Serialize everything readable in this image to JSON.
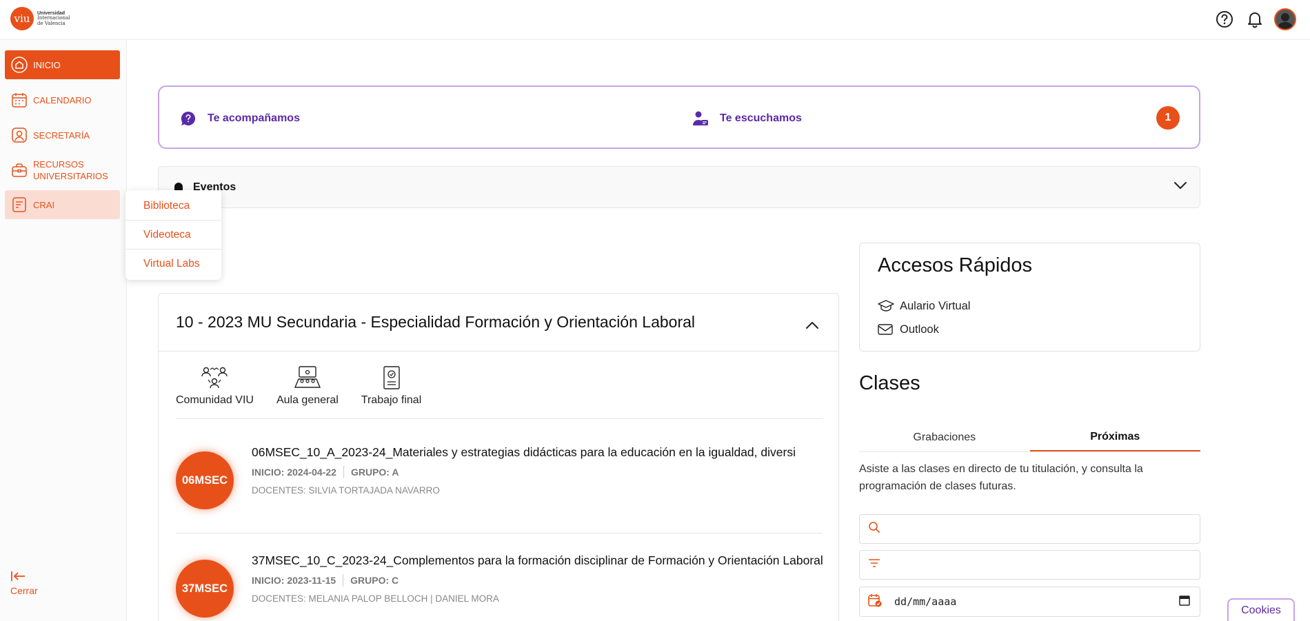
{
  "header": {
    "logo_mark": "viu",
    "logo_line1": "Universidad",
    "logo_line2": "Internacional",
    "logo_line3": "de Valencia",
    "icons": [
      "help-icon",
      "bell-icon",
      "avatar"
    ]
  },
  "sidebar": {
    "items": [
      {
        "label": "INICIO",
        "icon": "home-icon",
        "state": "active"
      },
      {
        "label": "CALENDARIO",
        "icon": "calendar-icon",
        "state": "normal"
      },
      {
        "label": "SECRETARÍA",
        "icon": "user-badge-icon",
        "state": "normal"
      },
      {
        "label": "RECURSOS UNIVERSITARIOS",
        "label_line1": "RECURSOS",
        "label_line2": "UNIVERSITARIOS",
        "icon": "briefcase-icon",
        "state": "normal"
      },
      {
        "label": "CRAI",
        "icon": "book-icon",
        "state": "highlight"
      }
    ],
    "close_label": "Cerrar"
  },
  "crai_menu": {
    "items": [
      "Biblioteca",
      "Videoteca",
      "Virtual Labs"
    ]
  },
  "banner": {
    "item1": "Te acompañamos",
    "item2": "Te escuchamos",
    "badge": "1"
  },
  "eventos": {
    "title": "Eventos"
  },
  "course": {
    "title": "10 - 2023 MU Secundaria - Especialidad Formación y Orientación Laboral",
    "tools": [
      {
        "label": "Comunidad VIU"
      },
      {
        "label": "Aula general"
      },
      {
        "label": "Trabajo final"
      }
    ],
    "subjects": [
      {
        "code": "06MSEC",
        "title": "06MSEC_10_A_2023-24_Materiales y estrategias didácticas para la educación en la igualdad, diversi",
        "inicio": "INICIO: 2024-04-22",
        "grupo": "GRUPO: A",
        "docentes": "DOCENTES: SILVIA TORTAJADA NAVARRO"
      },
      {
        "code": "37MSEC",
        "title": "37MSEC_10_C_2023-24_Complementos para la formación disciplinar de Formación y Orientación Laboral",
        "inicio": "INICIO: 2023-11-15",
        "grupo": "GRUPO: C",
        "docentes": "DOCENTES: MELANIA PALOP BELLOCH | DANIEL MORA"
      }
    ]
  },
  "quick_access": {
    "title": "Accesos Rápidos",
    "items": [
      "Aulario Virtual",
      "Outlook"
    ]
  },
  "clases": {
    "title": "Clases",
    "tabs": [
      "Grabaciones",
      "Próximas"
    ],
    "active_tab": "Próximas",
    "description": "Asiste a las clases en directo de tu titulación, y consulta la programación de clases futuras.",
    "search_value": "",
    "filter_value": "",
    "date_placeholder": "dd/mm/aaaa"
  },
  "cookies_label": "Cookies",
  "colors": {
    "accent": "#e8501a",
    "purple": "#5b2aa8",
    "purple_border": "#c7a3e6"
  }
}
